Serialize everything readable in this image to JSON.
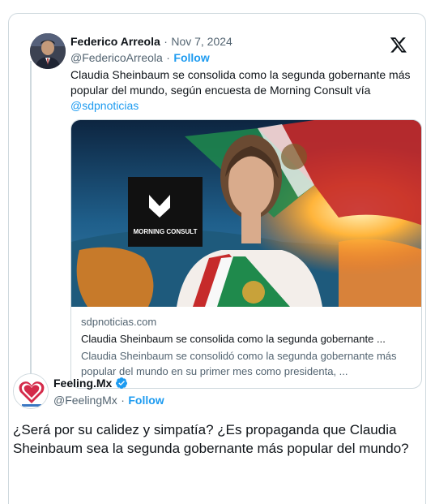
{
  "quoted_tweet": {
    "author_name": "Federico Arreola",
    "separator": "·",
    "date": "Nov 7, 2024",
    "handle": "@FedericoArreola",
    "follow_label": "Follow",
    "text": "Claudia Sheinbaum se consolida como la segunda gobernante más popular del mundo, según encuesta de Morning Consult vía",
    "mention": "@sdpnoticias",
    "platform_icon": "x-logo-icon"
  },
  "link_card": {
    "image_brand_text": "MORNING CONSULT",
    "domain": "sdpnoticias.com",
    "title": "Claudia Sheinbaum se consolida como la segunda gobernante ...",
    "description": "Claudia Sheinbaum se consolidó como la segunda gobernante más popular del mundo en su primer mes como presidenta, ..."
  },
  "main_tweet": {
    "author_name": "Feeling.Mx",
    "verified_icon": "verified-badge-icon",
    "handle": "@FeelingMx",
    "separator": "·",
    "follow_label": "Follow",
    "text": "¿Será por su calidez y simpatía? ¿Es propaganda que Claudia Sheinbaum sea la segunda gobernante más popular del mundo?"
  },
  "colors": {
    "link_blue": "#1d9bf0",
    "muted_gray": "#536471",
    "border": "#cfd9de",
    "text": "#0f1419"
  }
}
